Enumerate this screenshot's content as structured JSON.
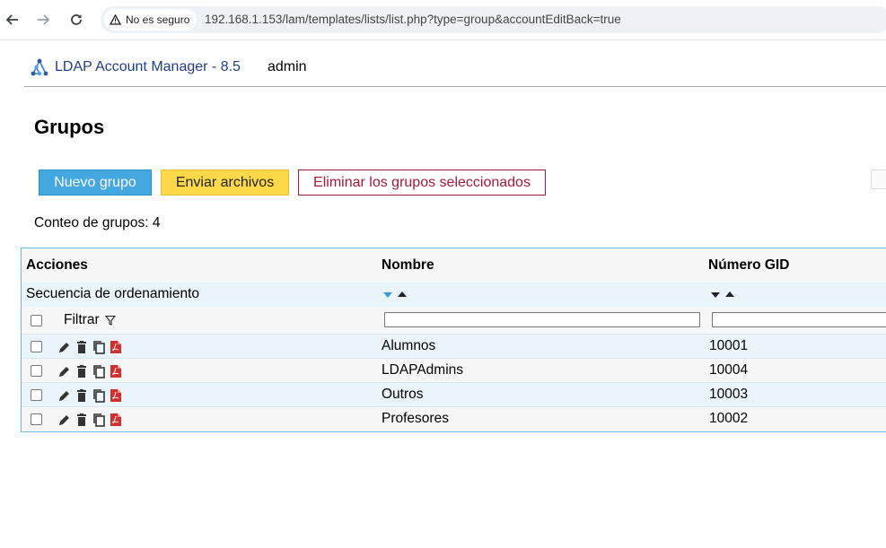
{
  "browser": {
    "security_label": "No es seguro",
    "url": "192.168.1.153/lam/templates/lists/list.php?type=group&accountEditBack=true"
  },
  "header": {
    "app_title": "LDAP Account Manager - 8.5",
    "user": "admin"
  },
  "page": {
    "title": "Grupos",
    "buttons": {
      "new": "Nuevo grupo",
      "upload": "Enviar archivos",
      "delete": "Eliminar los grupos seleccionados"
    },
    "count_text": "Conteo de grupos: 4"
  },
  "table": {
    "headers": [
      "Acciones",
      "Nombre",
      "Número GID"
    ],
    "sort_label": "Secuencia de ordenamiento",
    "filter_label": "Filtrar",
    "filter_values": [
      "",
      ""
    ],
    "rows": [
      {
        "name": "Alumnos",
        "gid": "10001"
      },
      {
        "name": "LDAPAdmins",
        "gid": "10004"
      },
      {
        "name": "Outros",
        "gid": "10003"
      },
      {
        "name": "Profesores",
        "gid": "10002"
      }
    ]
  },
  "colors": {
    "accent_blue": "#45a7e0",
    "upload_yellow": "#fdd949",
    "delete_red": "#a3193b",
    "title_blue": "#1f3d8a",
    "table_border": "#6cb8d6",
    "sort_active": "#3a9fd8",
    "pdf_red": "#d32f2f"
  },
  "icons": {
    "row_actions": [
      "edit-icon",
      "delete-icon",
      "copy-icon",
      "pdf-icon"
    ],
    "filter": "funnel-icon"
  }
}
